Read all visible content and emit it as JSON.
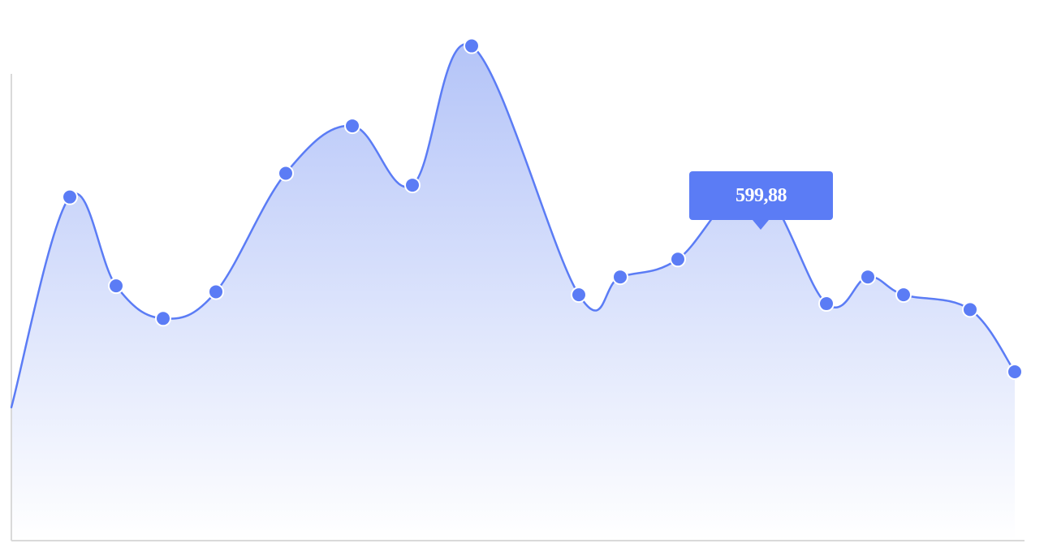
{
  "chart_data": {
    "type": "area",
    "x": [
      0,
      1,
      2,
      3,
      4,
      5,
      6,
      7,
      8,
      9,
      10,
      11,
      12,
      13,
      14,
      15,
      16,
      17,
      18
    ],
    "values": [
      290,
      580,
      430,
      375,
      420,
      620,
      700,
      600,
      835,
      415,
      440,
      470,
      600,
      400,
      445,
      415,
      390,
      285
    ],
    "series": [
      {
        "values": [
          225,
          580,
          430,
          375,
          420,
          620,
          700,
          600,
          835,
          415,
          445,
          475,
          600,
          400,
          445,
          415,
          390,
          285
        ]
      }
    ],
    "tooltip": {
      "text": "599,88",
      "index": 12
    },
    "grid": false,
    "ylim": [
      0,
      870
    ],
    "xlabel": "",
    "ylabel": ""
  },
  "colors": {
    "series": "#5b7cf5",
    "fill_top": "#b4c4f8",
    "fill_bottom": "#ffffff",
    "tooltip": "#5b7cf5",
    "axis": "#d9d9d9"
  }
}
